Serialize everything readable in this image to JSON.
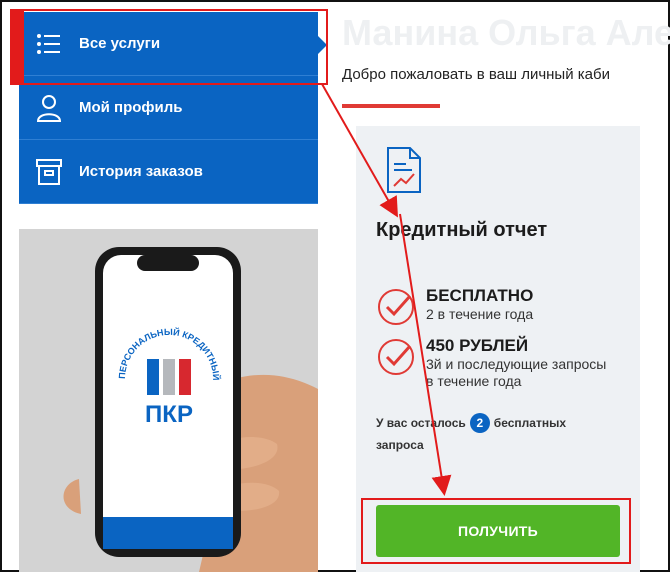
{
  "sidebar": {
    "items": [
      {
        "label": "Все услуги",
        "icon": "list-icon",
        "active": true
      },
      {
        "label": "Мой профиль",
        "icon": "user-icon",
        "active": false
      },
      {
        "label": "История заказов",
        "icon": "archive-box-icon",
        "active": false
      }
    ]
  },
  "banner": {
    "logo_text": "ПКР",
    "ring_text": "ПЕРСОНАЛЬНЫЙ КРЕДИТНЫЙ РЕЙТИНГ"
  },
  "header": {
    "user_name": "Манина Ольга Алек",
    "welcome": "Добро пожаловать в ваш личный каби"
  },
  "card": {
    "title": "Кредитный отчет",
    "offers": [
      {
        "price": "БЕСПЛАТНО",
        "desc": "2 в течение года"
      },
      {
        "price": "450 РУБЛЕЙ",
        "desc": "3й и последующие запросы в течение года"
      }
    ],
    "remaining_prefix": "У вас осталось",
    "remaining_count": "2",
    "remaining_suffix": "бесплатных",
    "remaining_line2": "запроса",
    "button_label": "ПОЛУЧИТЬ"
  },
  "colors": {
    "primary_blue": "#0a64c2",
    "button_green": "#52b527",
    "annotation_red": "#e21b1b"
  }
}
